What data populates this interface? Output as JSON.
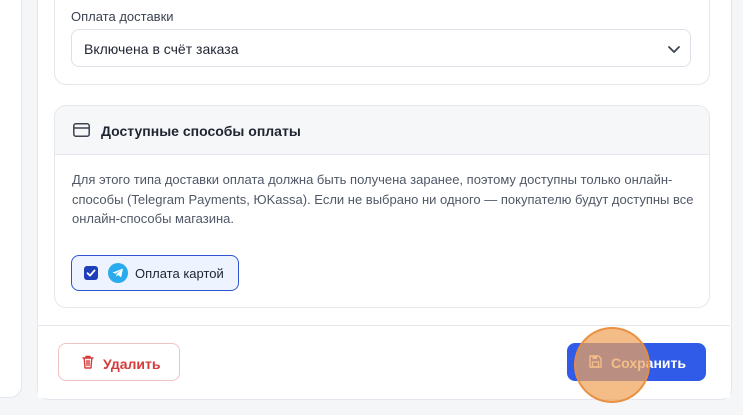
{
  "delivery_payment": {
    "label": "Оплата доставки",
    "selected": "Включена в счёт заказа"
  },
  "payment_methods": {
    "icon": "credit-card-icon",
    "title": "Доступные способы оплаты",
    "description": "Для этого типа доставки оплата должна быть получена заранее, поэтому доступны только онлайн-способы (Telegram Payments, ЮKassa). Если не выбрано ни одного — покупателю будут доступны все онлайн-способы магазина.",
    "options": [
      {
        "label": "Оплата картой",
        "checked": true,
        "icon": "telegram-icon"
      }
    ]
  },
  "footer": {
    "delete_label": "Удалить",
    "save_label": "Сохранить"
  },
  "colors": {
    "primary": "#2f5be8",
    "danger": "#d63a3a",
    "telegram": "#2aabee",
    "click_marker": "#f0a45a"
  }
}
